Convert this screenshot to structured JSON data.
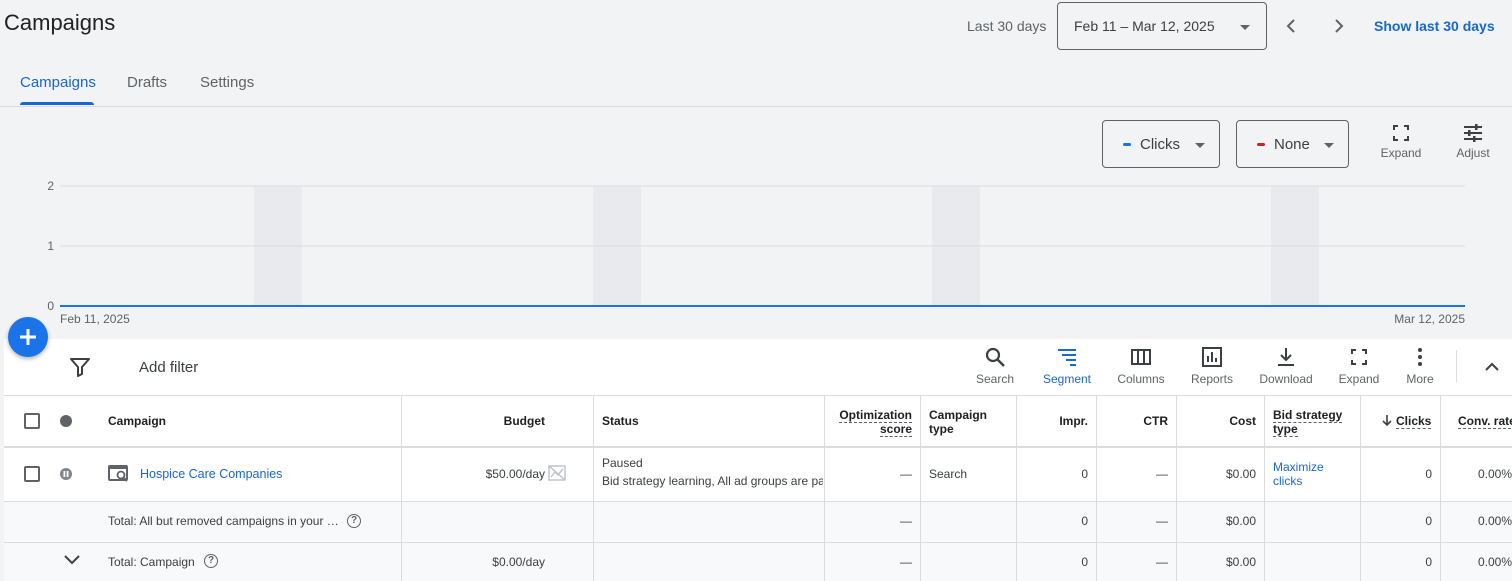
{
  "header": {
    "title": "Campaigns",
    "range_label": "Last 30 days",
    "date_range": "Feb 11 – Mar 12, 2025",
    "show_last": "Show last 30 days"
  },
  "tabs": [
    {
      "label": "Campaigns",
      "active": true
    },
    {
      "label": "Drafts",
      "active": false
    },
    {
      "label": "Settings",
      "active": false
    }
  ],
  "chart_controls": {
    "metric1": {
      "label": "Clicks",
      "color": "#1a73e8"
    },
    "metric2": {
      "label": "None",
      "color": "#c5221f"
    },
    "expand_label": "Expand",
    "adjust_label": "Adjust"
  },
  "chart_data": {
    "type": "line",
    "x_start": "Feb 11, 2025",
    "x_end": "Mar 12, 2025",
    "y_ticks": [
      "2",
      "1",
      "0"
    ],
    "ylim": [
      0,
      2
    ],
    "series": [
      {
        "values": [
          0,
          0,
          0,
          0,
          0,
          0,
          0,
          0,
          0,
          0,
          0,
          0,
          0,
          0,
          0,
          0,
          0,
          0,
          0,
          0,
          0,
          0,
          0,
          0,
          0,
          0,
          0,
          0,
          0,
          0
        ],
        "color": "#1a73e8"
      }
    ]
  },
  "toolbar": {
    "add_filter": "Add filter",
    "search": "Search",
    "segment": "Segment",
    "columns": "Columns",
    "reports": "Reports",
    "download": "Download",
    "expand": "Expand",
    "more": "More"
  },
  "table": {
    "headers": {
      "campaign": "Campaign",
      "budget": "Budget",
      "status": "Status",
      "opt_score_1": "Optimization",
      "opt_score_2": "score",
      "campaign_type_1": "Campaign",
      "campaign_type_2": "type",
      "impr": "Impr.",
      "ctr": "CTR",
      "cost": "Cost",
      "bid_1": "Bid strategy",
      "bid_2": "type",
      "clicks": "Clicks",
      "conv_rate": "Conv. rate"
    },
    "row": {
      "campaign": "Hospice Care Companies",
      "budget": "$50.00/day",
      "status": "Paused",
      "status_detail": "Bid strategy learning, All ad groups are paused",
      "opt_score": "—",
      "campaign_type": "Search",
      "impr": "0",
      "ctr": "—",
      "cost": "$0.00",
      "bid_1": "Maximize",
      "bid_2": "clicks",
      "clicks": "0",
      "conv_rate": "0.00%"
    },
    "total_removed": {
      "label": "Total: All but removed campaigns in your …",
      "opt_score": "—",
      "impr": "0",
      "ctr": "—",
      "cost": "$0.00",
      "clicks": "0",
      "conv_rate": "0.00%"
    },
    "total_campaign": {
      "label": "Total: Campaign",
      "budget": "$0.00/day",
      "opt_score": "—",
      "impr": "0",
      "ctr": "—",
      "cost": "$0.00",
      "clicks": "0",
      "conv_rate": "0.00%"
    }
  }
}
